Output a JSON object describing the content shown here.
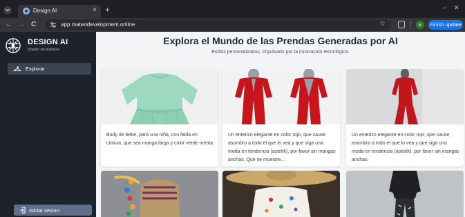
{
  "browser": {
    "tab_title": "Design AI",
    "tab_close": "×",
    "new_tab": "+",
    "url": "app.mateodevelopment.online",
    "finish_update": "Finish update",
    "back": "←",
    "forward": "→",
    "reload": "C",
    "star": "☆",
    "minimize": "–",
    "close": "✕"
  },
  "sidebar": {
    "brand_name": "DESIGN AI",
    "brand_sub": "Diseño de prendas",
    "nav_explore": "Explorar",
    "login": "Iniciar sesion"
  },
  "main": {
    "title": "Explora el Mundo de las Prendas Generadas por AI",
    "subtitle": "Estilos personalizados, impulsado por la innovación tecnológica.",
    "cards": [
      {
        "description": "Body de bebe, para una niña, con falda en cintura, que sea manga larga y color verde menta"
      },
      {
        "description": "Un enterizo elegante en color rojo, que cause asombro a todo el que lo vea y que siga una moda en tendencia (astetik), por favor sin mangas anchas. Que se muestre..."
      },
      {
        "description": "Un enterizo elegante en color rojo, que cause asombro a todo el que lo vea y que siga una moda en tendencia (astetik), por favor sin mangas anchas."
      }
    ]
  },
  "colors": {
    "sidebar_bg": "#1d222b",
    "nav_active_bg": "#3b4453",
    "login_bg": "#5e6f8b",
    "main_bg": "#f3f4f6",
    "accent_blue": "#1a73e8"
  },
  "icons": {
    "tab_switch": "chevron-down-icon",
    "logo": "brain-circuit-icon",
    "explore": "hanger-icon",
    "login": "login-icon"
  }
}
